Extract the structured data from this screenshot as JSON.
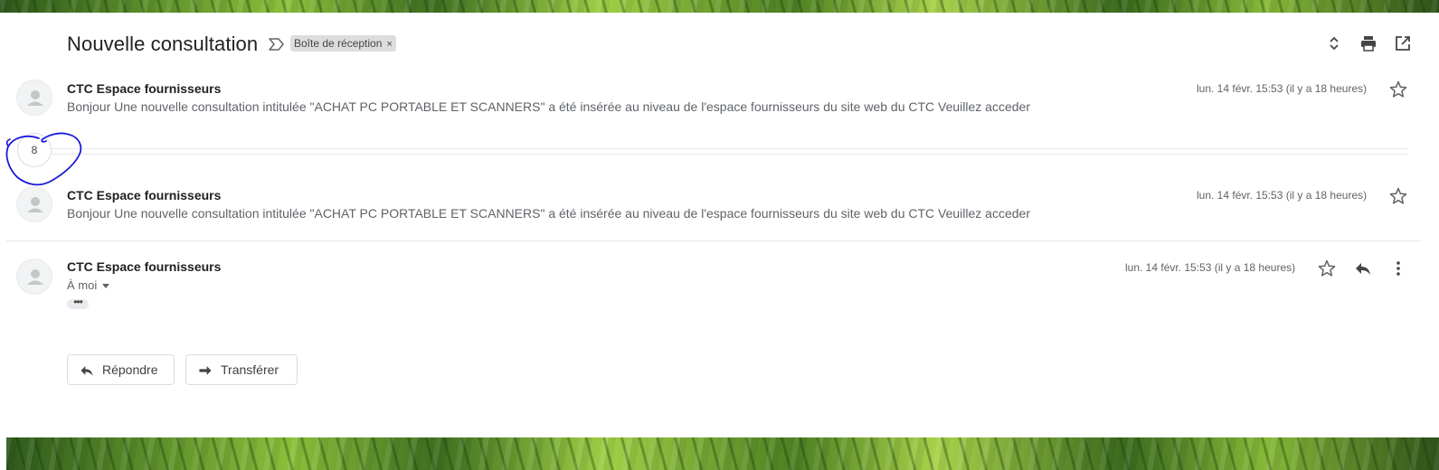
{
  "thread": {
    "subject": "Nouvelle consultation",
    "label": "Boîte de réception",
    "label_remove": "×"
  },
  "top_icons": [
    "expand-collapse-icon",
    "print-icon",
    "open-in-new-window-icon"
  ],
  "collapsed_count": "8",
  "messages": [
    {
      "sender": "CTC Espace fournisseurs",
      "snippet": "Bonjour Une nouvelle consultation intitulée \"ACHAT PC PORTABLE ET SCANNERS\" a été insérée au niveau de l'espace fournisseurs du site web du CTC Veuillez acceder",
      "date": "lun. 14 févr. 15:53 (il y a 18 heures)"
    },
    {
      "sender": "CTC Espace fournisseurs",
      "snippet": "Bonjour Une nouvelle consultation intitulée \"ACHAT PC PORTABLE ET SCANNERS\" a été insérée au niveau de l'espace fournisseurs du site web du CTC Veuillez acceder",
      "date": "lun. 14 févr. 15:53 (il y a 18 heures)"
    },
    {
      "sender": "CTC Espace fournisseurs",
      "recipient": "À moi",
      "date": "lun. 14 févr. 15:53 (il y a 18 heures)"
    }
  ],
  "actions": {
    "reply": "Répondre",
    "forward": "Transférer"
  },
  "colors": {
    "annotation_stroke": "#1a1adb",
    "text_primary": "#202124",
    "text_secondary": "#5f6368"
  }
}
